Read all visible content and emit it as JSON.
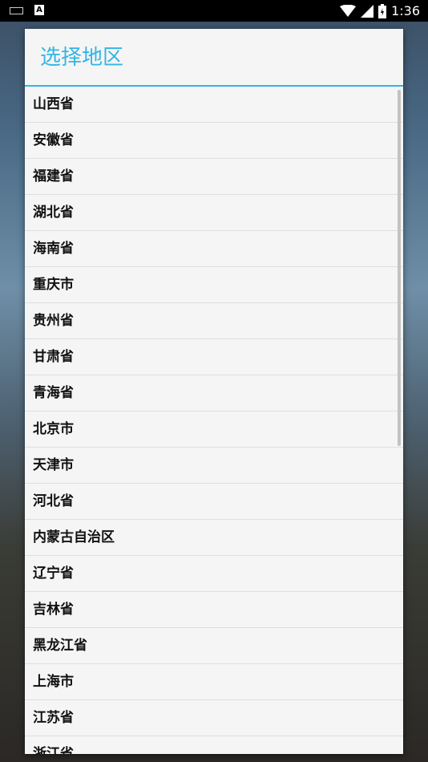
{
  "status_bar": {
    "time": "1:36"
  },
  "dialog": {
    "title": "选择地区",
    "regions": [
      "山西省",
      "安徽省",
      "福建省",
      "湖北省",
      "海南省",
      "重庆市",
      "贵州省",
      "甘肃省",
      "青海省",
      "北京市",
      "天津市",
      "河北省",
      "内蒙古自治区",
      "辽宁省",
      "吉林省",
      "黑龙江省",
      "上海市",
      "江苏省",
      "浙江省"
    ]
  },
  "colors": {
    "accent": "#33b5e5",
    "dialog_bg": "#f5f5f5",
    "status_bar": "#000000"
  }
}
